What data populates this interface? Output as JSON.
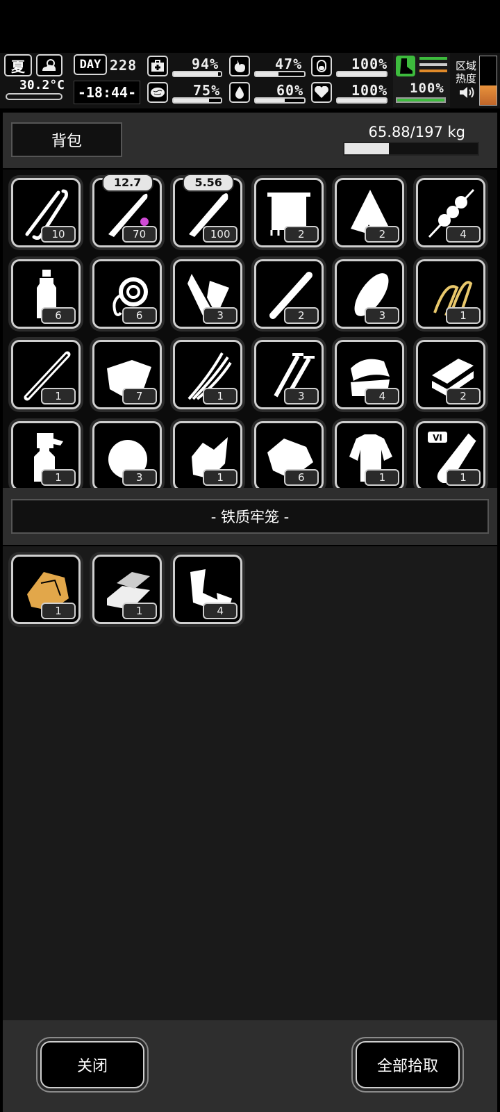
{
  "hud": {
    "season": "夏",
    "temperature": "30.2°C",
    "day_label": "DAY",
    "day_number": "228",
    "clock": "-18:44-",
    "stats": [
      {
        "icon": "medkit-icon",
        "value": "94%",
        "level": 0.94
      },
      {
        "icon": "brain-icon",
        "value": "75%",
        "level": 0.75
      },
      {
        "icon": "stomach-icon",
        "value": "47%",
        "level": 0.47
      },
      {
        "icon": "water-drop-icon",
        "value": "60%",
        "level": 0.6
      },
      {
        "icon": "bladder-icon",
        "value": "100%",
        "level": 1.0
      },
      {
        "icon": "heart-icon",
        "value": "100%",
        "level": 1.0
      }
    ],
    "stamina_value": "100%",
    "stamina_level": 1.0,
    "zone_heat_label_1": "区域",
    "zone_heat_label_2": "热度",
    "colors": {
      "stamina": "#3dbb3d",
      "heat_high": "#e08a2a"
    }
  },
  "backpack": {
    "title": "背包",
    "weight": "65.88/197 kg",
    "weight_fraction": 0.334,
    "items": [
      {
        "icon": "lockpick-icon",
        "count": "10"
      },
      {
        "icon": "rifle-round-icon",
        "count": "70",
        "caliber": "12.7"
      },
      {
        "icon": "bullet-icon",
        "count": "100",
        "caliber": "5.56"
      },
      {
        "icon": "towel-icon",
        "count": "2"
      },
      {
        "icon": "cloth-rag-icon",
        "count": "2"
      },
      {
        "icon": "meat-skewer-icon",
        "count": "4"
      },
      {
        "icon": "water-bottle-icon",
        "count": "6"
      },
      {
        "icon": "rope-icon",
        "count": "6"
      },
      {
        "icon": "bandage-roll-icon",
        "count": "3"
      },
      {
        "icon": "pipe-icon",
        "count": "2"
      },
      {
        "icon": "bread-icon",
        "count": "3"
      },
      {
        "icon": "gold-hairpin-icon",
        "count": "1"
      },
      {
        "icon": "metal-tube-icon",
        "count": "1"
      },
      {
        "icon": "fabric-icon",
        "count": "7"
      },
      {
        "icon": "wires-icon",
        "count": "1"
      },
      {
        "icon": "screws-icon",
        "count": "3"
      },
      {
        "icon": "folded-clothes-icon",
        "count": "4"
      },
      {
        "icon": "bricks-icon",
        "count": "2"
      },
      {
        "icon": "spray-bottle-icon",
        "count": "1"
      },
      {
        "icon": "cotton-icon",
        "count": "3"
      },
      {
        "icon": "scrap-icon",
        "count": "1"
      },
      {
        "icon": "ore-icon",
        "count": "6"
      },
      {
        "icon": "shirt-icon",
        "count": "1"
      },
      {
        "icon": "test-tube-icon",
        "count": "1"
      }
    ]
  },
  "container": {
    "title": "- 铁质牢笼 -",
    "items": [
      {
        "icon": "gold-nugget-icon",
        "count": "1"
      },
      {
        "icon": "silver-ingot-icon",
        "count": "1"
      },
      {
        "icon": "pipe-scrap-icon",
        "count": "4"
      }
    ]
  },
  "footer": {
    "close_label": "关闭",
    "take_all_label": "全部拾取"
  }
}
